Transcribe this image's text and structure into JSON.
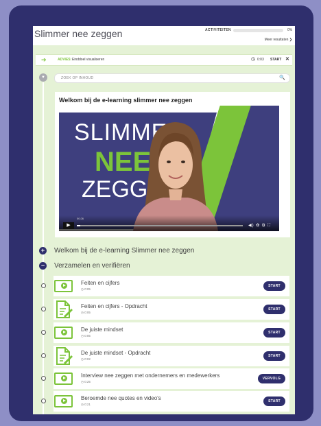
{
  "header": {
    "course_title": "Slimmer nee zeggen",
    "activities_label": "ACTIVITEITEN",
    "progress_percent": 0,
    "progress_text": "0%",
    "more_results": "Meer resultaten ❯"
  },
  "advice": {
    "label": "ADVIES:",
    "text": "Einddoel visualiseren",
    "time": "0:03",
    "start_label": "START",
    "close_glyph": "✕",
    "arrow_glyph": "➔",
    "clock_glyph": "◷"
  },
  "search": {
    "placeholder": "ZOEK OP INHOUD",
    "icon_glyph": "🔍",
    "collapse_glyph": "▼"
  },
  "welcome_video": {
    "title": "Welkom bij de e-learning slimmer nee zeggen",
    "slide_words": [
      "SLIMMER",
      "NEE",
      "ZEGGEN"
    ],
    "current_time": "00:26",
    "play_glyph": "▶",
    "controls_glyph": "◀) ✿ ⧉ ⛶",
    "played_fraction": 0.02
  },
  "sections": [
    {
      "icon": "+",
      "label": "Welkom bij de e-learning Slimmer nee zeggen"
    },
    {
      "icon": "−",
      "label": "Verzamelen en verifiëren"
    }
  ],
  "lessons": [
    {
      "type": "video",
      "title": "Feiten en cijfers",
      "duration": "◷ 0:05",
      "button": "START"
    },
    {
      "type": "assignment",
      "title": "Feiten en cijfers - Opdracht",
      "duration": "◷ 0:05",
      "button": "START"
    },
    {
      "type": "video",
      "title": "De juiste mindset",
      "duration": "◷ 0:05",
      "button": "START"
    },
    {
      "type": "assignment",
      "title": "De juiste mindset - Opdracht",
      "duration": "◷ 0:02",
      "button": "START"
    },
    {
      "type": "video",
      "title": "Interview nee zeggen met ondernemers en medewerkers",
      "duration": "◷ 0:25",
      "button": "VERVOLG"
    },
    {
      "type": "video",
      "title": "Beroemde nee quotes en video's",
      "duration": "◷ 0:21",
      "button": "START"
    }
  ],
  "colors": {
    "accent_green": "#7cc43a",
    "navy": "#2f2f6d",
    "panel_green": "#e5f2d6",
    "outer_bg": "#8e8fc6"
  }
}
